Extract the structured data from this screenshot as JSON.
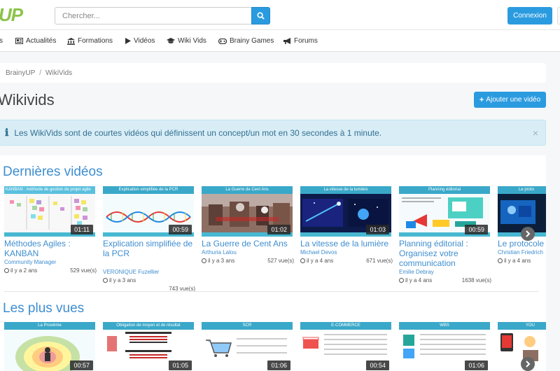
{
  "header": {
    "logo_text": "UP",
    "search_placeholder": "Chercher...",
    "login_label": "Connexion"
  },
  "nav": {
    "items": [
      {
        "label": "s",
        "icon": "none"
      },
      {
        "label": "Actualités",
        "icon": "newspaper-icon"
      },
      {
        "label": "Formations",
        "icon": "institution-icon"
      },
      {
        "label": "Vidéos",
        "icon": "play-icon"
      },
      {
        "label": "Wiki Vids",
        "icon": "graduation-cap-icon"
      },
      {
        "label": "Brainy Games",
        "icon": "gamepad-icon"
      },
      {
        "label": "Forums",
        "icon": "bullhorn-icon"
      }
    ]
  },
  "breadcrumb": {
    "items": [
      "BrainyUP",
      "WikiVids"
    ],
    "separator": "/"
  },
  "page": {
    "title": "Wikivids",
    "add_button": "Ajouter une vidéo",
    "info": "Les WikiVids sont de courtes vidéos qui définissent un concept/un mot en 30 secondes à 1 minute.",
    "close": "×"
  },
  "sections": {
    "latest": {
      "title": "Dernières vidéos",
      "videos": [
        {
          "thumb_caption": "KANBAN : méthode de gestion de projet agile",
          "duration": "01:11",
          "title": "Méthodes Agiles : KANBAN",
          "author": "Community Manager",
          "age": "il y a 2 ans",
          "views": "529 vue(s)"
        },
        {
          "thumb_caption": "Explication simplifiée de la PCR",
          "duration": "00:59",
          "title": "Explication simplifiée de la PCR",
          "author": "VERONIQUE Fuzellier",
          "age": "il y a 3 ans",
          "views": "743 vue(s)"
        },
        {
          "thumb_caption": "La Guerre de Cent Ans",
          "duration": "01:02",
          "title": "La Guerre de Cent Ans",
          "author": "Arthuria Lalou",
          "age": "il y a 3 ans",
          "views": "527 vue(s)"
        },
        {
          "thumb_caption": "La vitesse de la lumière",
          "duration": "01:03",
          "title": "La vitesse de la lumière",
          "author": "Michael Devos",
          "age": "il y a 4 ans",
          "views": "671 vue(s)"
        },
        {
          "thumb_caption": "Planning éditorial",
          "duration": "00:59",
          "title": "Planning éditorial : Organisez votre communication",
          "author": "Emilie Debray",
          "age": "il y a 4 ans",
          "views": "1638 vue(s)"
        },
        {
          "thumb_caption": "Le proto",
          "duration": "",
          "title": "Le protocole",
          "author": "Christian Friedrich",
          "age": "il y a 4 ans",
          "views": ""
        }
      ]
    },
    "popular": {
      "title": "Les plus vues",
      "videos": [
        {
          "thumb_caption": "La Proxémie",
          "duration": "00:57"
        },
        {
          "thumb_caption": "Obligation de moyen et de résultat",
          "duration": "01:05"
        },
        {
          "thumb_caption": "SCR",
          "duration": "01:06"
        },
        {
          "thumb_caption": "E-COMMERCE",
          "duration": "00:54"
        },
        {
          "thumb_caption": "WBS",
          "duration": "01:06"
        },
        {
          "thumb_caption": "YOU",
          "duration": ""
        }
      ]
    }
  }
}
